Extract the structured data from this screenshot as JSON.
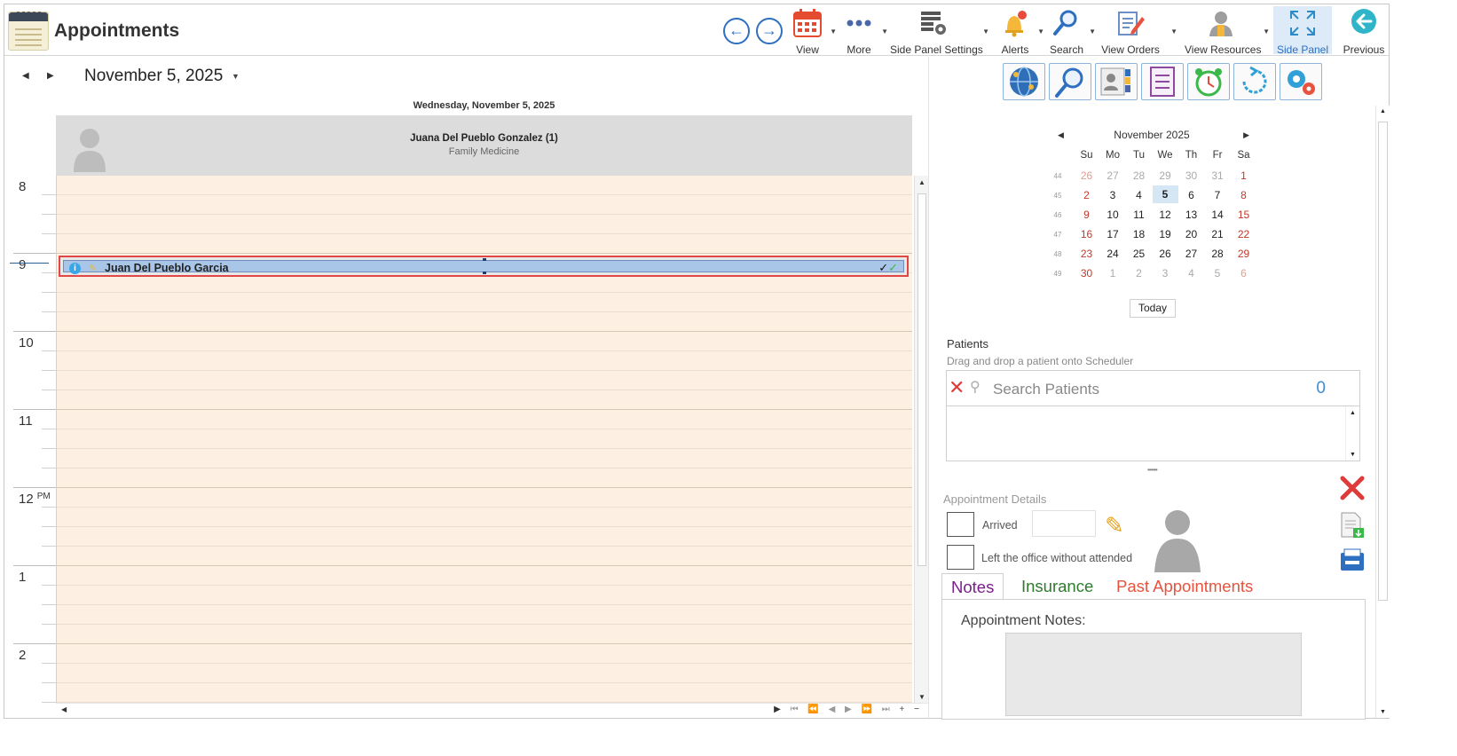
{
  "app": {
    "title": "Appointments"
  },
  "toolbar": {
    "buttons": [
      {
        "label": "View",
        "icon": "calendar-icon"
      },
      {
        "label": "More",
        "icon": "more-dots-icon"
      },
      {
        "label": "Side Panel Settings",
        "icon": "table-gear-icon"
      },
      {
        "label": "Alerts",
        "icon": "bell-icon"
      },
      {
        "label": "Search",
        "icon": "search-icon"
      },
      {
        "label": "View Orders",
        "icon": "edit-document-icon"
      },
      {
        "label": "View Resources",
        "icon": "person-icon"
      },
      {
        "label": "Side Panel",
        "icon": "expand-icon"
      },
      {
        "label": "Previous",
        "icon": "back-arrow-icon"
      }
    ],
    "back_arrow": "←",
    "forward_arrow": "→"
  },
  "scheduler": {
    "date": "November 5, 2025",
    "day_caption": "Wednesday, November 5, 2025",
    "resource": {
      "name": "Juana Del Pueblo Gonzalez (1)",
      "specialty": "Family Medicine"
    },
    "hours": [
      "8",
      "9",
      "10",
      "11",
      "12",
      "1",
      "2"
    ],
    "pm_marker": "PM",
    "appointment": {
      "patient": "Juan Del Pueblo Garcia",
      "info": "i",
      "checks": "✓✓"
    },
    "colors": {
      "grid": "#fdf0e2",
      "appointment": "#a9c6e8",
      "selection_border": "#e04848"
    }
  },
  "side_panel": {
    "tool_icons": [
      "globe-network-icon",
      "search-icon",
      "contact-card-icon",
      "checklist-icon",
      "alarm-clock-icon",
      "refresh-icon",
      "gears-icon"
    ],
    "mini_calendar": {
      "title": "November 2025",
      "dow": [
        "Su",
        "Mo",
        "Tu",
        "We",
        "Th",
        "Fr",
        "Sa"
      ],
      "weeks": [
        {
          "wk": "44",
          "days": [
            "26",
            "27",
            "28",
            "29",
            "30",
            "31",
            "1"
          ]
        },
        {
          "wk": "45",
          "days": [
            "2",
            "3",
            "4",
            "5",
            "6",
            "7",
            "8"
          ]
        },
        {
          "wk": "46",
          "days": [
            "9",
            "10",
            "11",
            "12",
            "13",
            "14",
            "15"
          ]
        },
        {
          "wk": "47",
          "days": [
            "16",
            "17",
            "18",
            "19",
            "20",
            "21",
            "22"
          ]
        },
        {
          "wk": "48",
          "days": [
            "23",
            "24",
            "25",
            "26",
            "27",
            "28",
            "29"
          ]
        },
        {
          "wk": "49",
          "days": [
            "30",
            "1",
            "2",
            "3",
            "4",
            "5",
            "6"
          ]
        }
      ],
      "selected": "5",
      "today_label": "Today"
    },
    "patients": {
      "label": "Patients",
      "hint": "Drag and drop a patient onto Scheduler",
      "search_placeholder": "Search Patients",
      "count": "0"
    },
    "appointment_details": {
      "label": "Appointment Details",
      "arrived_label": "Arrived",
      "left_label": "Left the office without attended"
    },
    "tabs": [
      {
        "label": "Notes",
        "color": "#7b1e8c"
      },
      {
        "label": "Insurance",
        "color": "#2f7a2f"
      },
      {
        "label": "Past Appointments",
        "color": "#e8533f"
      }
    ],
    "notes_label": "Appointment Notes:"
  }
}
